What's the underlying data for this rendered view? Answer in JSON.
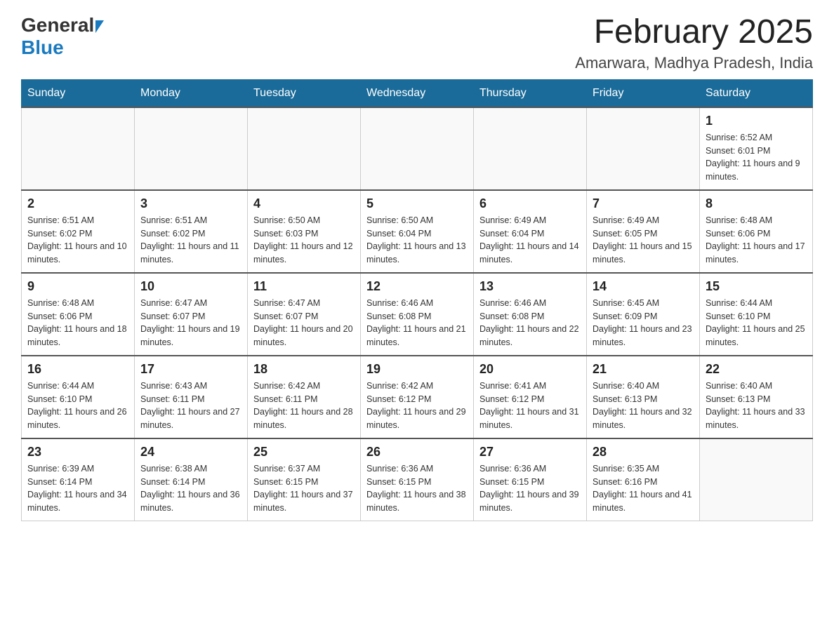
{
  "header": {
    "logo_general": "General",
    "logo_blue": "Blue",
    "month_title": "February 2025",
    "location": "Amarwara, Madhya Pradesh, India"
  },
  "days_of_week": [
    "Sunday",
    "Monday",
    "Tuesday",
    "Wednesday",
    "Thursday",
    "Friday",
    "Saturday"
  ],
  "weeks": [
    [
      {
        "day": "",
        "info": ""
      },
      {
        "day": "",
        "info": ""
      },
      {
        "day": "",
        "info": ""
      },
      {
        "day": "",
        "info": ""
      },
      {
        "day": "",
        "info": ""
      },
      {
        "day": "",
        "info": ""
      },
      {
        "day": "1",
        "info": "Sunrise: 6:52 AM\nSunset: 6:01 PM\nDaylight: 11 hours and 9 minutes."
      }
    ],
    [
      {
        "day": "2",
        "info": "Sunrise: 6:51 AM\nSunset: 6:02 PM\nDaylight: 11 hours and 10 minutes."
      },
      {
        "day": "3",
        "info": "Sunrise: 6:51 AM\nSunset: 6:02 PM\nDaylight: 11 hours and 11 minutes."
      },
      {
        "day": "4",
        "info": "Sunrise: 6:50 AM\nSunset: 6:03 PM\nDaylight: 11 hours and 12 minutes."
      },
      {
        "day": "5",
        "info": "Sunrise: 6:50 AM\nSunset: 6:04 PM\nDaylight: 11 hours and 13 minutes."
      },
      {
        "day": "6",
        "info": "Sunrise: 6:49 AM\nSunset: 6:04 PM\nDaylight: 11 hours and 14 minutes."
      },
      {
        "day": "7",
        "info": "Sunrise: 6:49 AM\nSunset: 6:05 PM\nDaylight: 11 hours and 15 minutes."
      },
      {
        "day": "8",
        "info": "Sunrise: 6:48 AM\nSunset: 6:06 PM\nDaylight: 11 hours and 17 minutes."
      }
    ],
    [
      {
        "day": "9",
        "info": "Sunrise: 6:48 AM\nSunset: 6:06 PM\nDaylight: 11 hours and 18 minutes."
      },
      {
        "day": "10",
        "info": "Sunrise: 6:47 AM\nSunset: 6:07 PM\nDaylight: 11 hours and 19 minutes."
      },
      {
        "day": "11",
        "info": "Sunrise: 6:47 AM\nSunset: 6:07 PM\nDaylight: 11 hours and 20 minutes."
      },
      {
        "day": "12",
        "info": "Sunrise: 6:46 AM\nSunset: 6:08 PM\nDaylight: 11 hours and 21 minutes."
      },
      {
        "day": "13",
        "info": "Sunrise: 6:46 AM\nSunset: 6:08 PM\nDaylight: 11 hours and 22 minutes."
      },
      {
        "day": "14",
        "info": "Sunrise: 6:45 AM\nSunset: 6:09 PM\nDaylight: 11 hours and 23 minutes."
      },
      {
        "day": "15",
        "info": "Sunrise: 6:44 AM\nSunset: 6:10 PM\nDaylight: 11 hours and 25 minutes."
      }
    ],
    [
      {
        "day": "16",
        "info": "Sunrise: 6:44 AM\nSunset: 6:10 PM\nDaylight: 11 hours and 26 minutes."
      },
      {
        "day": "17",
        "info": "Sunrise: 6:43 AM\nSunset: 6:11 PM\nDaylight: 11 hours and 27 minutes."
      },
      {
        "day": "18",
        "info": "Sunrise: 6:42 AM\nSunset: 6:11 PM\nDaylight: 11 hours and 28 minutes."
      },
      {
        "day": "19",
        "info": "Sunrise: 6:42 AM\nSunset: 6:12 PM\nDaylight: 11 hours and 29 minutes."
      },
      {
        "day": "20",
        "info": "Sunrise: 6:41 AM\nSunset: 6:12 PM\nDaylight: 11 hours and 31 minutes."
      },
      {
        "day": "21",
        "info": "Sunrise: 6:40 AM\nSunset: 6:13 PM\nDaylight: 11 hours and 32 minutes."
      },
      {
        "day": "22",
        "info": "Sunrise: 6:40 AM\nSunset: 6:13 PM\nDaylight: 11 hours and 33 minutes."
      }
    ],
    [
      {
        "day": "23",
        "info": "Sunrise: 6:39 AM\nSunset: 6:14 PM\nDaylight: 11 hours and 34 minutes."
      },
      {
        "day": "24",
        "info": "Sunrise: 6:38 AM\nSunset: 6:14 PM\nDaylight: 11 hours and 36 minutes."
      },
      {
        "day": "25",
        "info": "Sunrise: 6:37 AM\nSunset: 6:15 PM\nDaylight: 11 hours and 37 minutes."
      },
      {
        "day": "26",
        "info": "Sunrise: 6:36 AM\nSunset: 6:15 PM\nDaylight: 11 hours and 38 minutes."
      },
      {
        "day": "27",
        "info": "Sunrise: 6:36 AM\nSunset: 6:15 PM\nDaylight: 11 hours and 39 minutes."
      },
      {
        "day": "28",
        "info": "Sunrise: 6:35 AM\nSunset: 6:16 PM\nDaylight: 11 hours and 41 minutes."
      },
      {
        "day": "",
        "info": ""
      }
    ]
  ]
}
